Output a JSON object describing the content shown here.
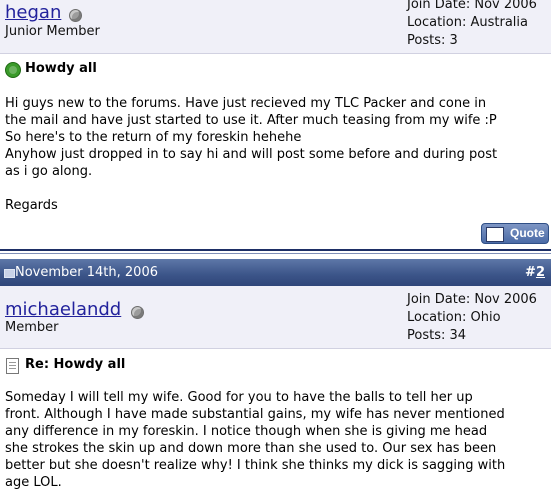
{
  "post1": {
    "username": "hegan",
    "rank": "Junior Member",
    "join_date": "Join Date: Nov 2006",
    "location": "Location: Australia",
    "posts": "Posts: 3",
    "title": "Howdy all",
    "body_lines": [
      "Hi guys new to the forums. Have just recieved my TLC Packer and cone in",
      "the mail and have just started to use it. After much teasing from my wife :P",
      "So here's to the return of my foreskin hehehe",
      "Anyhow just dropped in to say hi and will post some before and during post",
      "as i go along.",
      "",
      "Regards"
    ],
    "quote_label": "Quote"
  },
  "post2_header": {
    "date": "November 14th, 2006",
    "post_number_prefix": "#",
    "post_number": "2"
  },
  "post2": {
    "username": "michaelandd",
    "rank": "Member",
    "join_date": "Join Date: Nov 2006",
    "location": "Location: Ohio",
    "posts": "Posts: 34",
    "title": "Re: Howdy all",
    "body_lines": [
      "Someday I will tell my wife. Good for you to have the balls to tell her up",
      "front. Although I have made substantial gains, my wife has never mentioned",
      "any difference in my foreskin. I notice though when she is giving me head",
      "she strokes the skin up and down more than she used to. Our sex has been",
      "better but she doesn't realize why! I think she thinks my dick is sagging with",
      "age LOL."
    ]
  },
  "colors": {
    "username": "#22229c",
    "header_bar": "#3b5488",
    "user_bar_bg": "#f0f0f8"
  },
  "icons": {
    "status": "offline-status-icon",
    "post1_icon": "smiley-icon",
    "post2_icon": "document-icon",
    "date_icon": "old-post-icon"
  }
}
